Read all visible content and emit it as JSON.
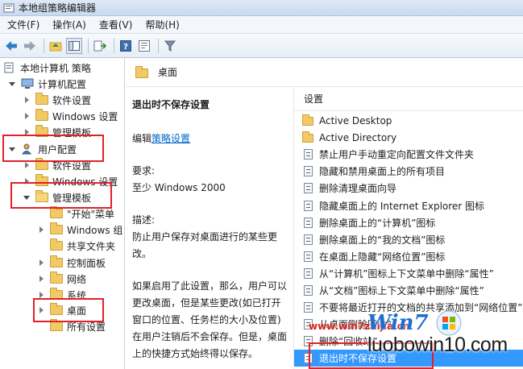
{
  "window": {
    "title": "本地组策略编辑器"
  },
  "menu": [
    "文件(F)",
    "操作(A)",
    "查看(V)",
    "帮助(H)"
  ],
  "toolbar": {
    "buttons": [
      "back-arrow-icon",
      "forward-arrow-icon",
      "up-folder-icon",
      "show-hide-tree-icon",
      "export-list-icon",
      "help-icon",
      "properties-icon",
      "filter-icon"
    ]
  },
  "tree": {
    "items": [
      {
        "label": "本地计算机 策略",
        "icon": "computer-policy-icon",
        "expander": "none",
        "selected": false
      },
      {
        "label": "计算机配置",
        "icon": "computer-icon",
        "expander": "down",
        "selected": false
      },
      {
        "label": "软件设置",
        "icon": "folder-icon",
        "expander": "right",
        "selected": false
      },
      {
        "label": "Windows 设置",
        "icon": "folder-icon",
        "expander": "right",
        "selected": false
      },
      {
        "label": "管理模板",
        "icon": "folder-icon",
        "expander": "right",
        "selected": false
      },
      {
        "label": "用户配置",
        "icon": "user-icon",
        "expander": "down",
        "selected": false
      },
      {
        "label": "软件设置",
        "icon": "folder-icon",
        "expander": "right",
        "selected": false
      },
      {
        "label": "Windows 设置",
        "icon": "folder-icon",
        "expander": "right",
        "selected": false
      },
      {
        "label": "管理模板",
        "icon": "folder-icon",
        "expander": "down",
        "selected": false
      },
      {
        "label": "\"开始\"菜单",
        "icon": "folder-icon",
        "expander": "none",
        "selected": false
      },
      {
        "label": "Windows 组",
        "icon": "folder-icon",
        "expander": "right",
        "selected": false
      },
      {
        "label": "共享文件夹",
        "icon": "folder-icon",
        "expander": "none",
        "selected": false
      },
      {
        "label": "控制面板",
        "icon": "folder-icon",
        "expander": "right",
        "selected": false
      },
      {
        "label": "网络",
        "icon": "folder-icon",
        "expander": "right",
        "selected": false
      },
      {
        "label": "系统",
        "icon": "folder-icon",
        "expander": "right",
        "selected": false
      },
      {
        "label": "桌面",
        "icon": "folder-icon",
        "expander": "right",
        "selected": true
      },
      {
        "label": "所有设置",
        "icon": "folder-icon",
        "expander": "none",
        "selected": false
      }
    ]
  },
  "content": {
    "header": "桌面",
    "description": {
      "title": "退出时不保存设置",
      "edit_prefix": "编辑",
      "edit_link": "策略设置",
      "requirements_label": "要求:",
      "requirements_value": "至少 Windows 2000",
      "description_label": "描述:",
      "description_text": "防止用户保存对桌面进行的某些更改。",
      "detail": "如果启用了此设置，那么，用户可以更改桌面，但是某些更改(如已打开窗口的位置、任务栏的大小及位置)在用户注销后不会保存。但是，桌面上的快捷方式始终得以保存。"
    },
    "list_header": "设置",
    "settings": [
      {
        "label": "Active Desktop",
        "icon": "folder-icon",
        "selected": false
      },
      {
        "label": "Active Directory",
        "icon": "folder-icon",
        "selected": false
      },
      {
        "label": "禁止用户手动重定向配置文件文件夹",
        "icon": "setting-icon",
        "selected": false
      },
      {
        "label": "隐藏和禁用桌面上的所有项目",
        "icon": "setting-icon",
        "selected": false
      },
      {
        "label": "删除清理桌面向导",
        "icon": "setting-icon",
        "selected": false
      },
      {
        "label": "隐藏桌面上的 Internet Explorer 图标",
        "icon": "setting-icon",
        "selected": false
      },
      {
        "label": "删除桌面上的“计算机”图标",
        "icon": "setting-icon",
        "selected": false
      },
      {
        "label": "删除桌面上的“我的文档”图标",
        "icon": "setting-icon",
        "selected": false
      },
      {
        "label": "在桌面上隐藏“网络位置”图标",
        "icon": "setting-icon",
        "selected": false
      },
      {
        "label": "从“计算机”图标上下文菜单中删除“属性”",
        "icon": "setting-icon",
        "selected": false
      },
      {
        "label": "从“文档”图标上下文菜单中删除“属性”",
        "icon": "setting-icon",
        "selected": false
      },
      {
        "label": "不要将最近打开的文档的共享添加到“网络位置”",
        "icon": "setting-icon",
        "selected": false
      },
      {
        "label": "从桌面删除回收站",
        "icon": "setting-icon",
        "selected": false
      },
      {
        "label": "删除“回收站”...",
        "icon": "setting-icon",
        "selected": false
      },
      {
        "label": "退出时不保存设置",
        "icon": "setting-icon",
        "selected": true
      }
    ]
  },
  "watermark": {
    "logo_text": "Win7",
    "small_url": "www.win7zhijia.cn",
    "site": "luobowin10.com"
  },
  "colors": {
    "highlight_box": "#e2202a",
    "selection": "#3399ff",
    "link": "#0066cc"
  }
}
